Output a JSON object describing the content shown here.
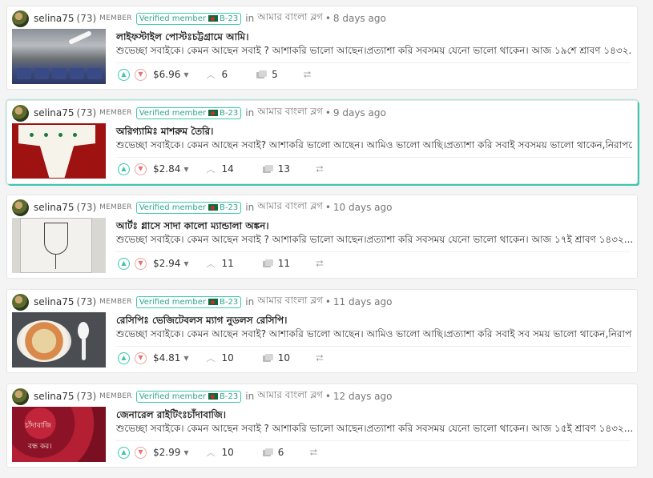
{
  "posts": [
    {
      "username": "selina75",
      "reputation": "(73)",
      "member_badge": "MEMBER",
      "verified": "Verified member",
      "verified_code": "B-23",
      "in_label": "in",
      "community": "আমার বাংলা ব্লগ",
      "age": "8 days ago",
      "title": "লাইফস্টাইল পোস্টঃচট্টগ্রামে আমি।",
      "excerpt": "শুভেচ্ছা সবাইকে। কেমন আছেন সবাই ? আশাকরি ভালো আছেন।প্রত্যাশা করি সবসময় যেনো ভালো থাকেন। আজ ১৯শে শ্রাবণ ১৪৩২...",
      "payout": "$6.96",
      "votes": "6",
      "comments": "5"
    },
    {
      "username": "selina75",
      "reputation": "(73)",
      "member_badge": "MEMBER",
      "verified": "Verified member",
      "verified_code": "B-23",
      "in_label": "in",
      "community": "আমার বাংলা ব্লগ",
      "age": "9 days ago",
      "title": "অরিগ্যামিঃ মাশরুম তৈরি।",
      "excerpt": "শুভেচ্ছা সবাইকে। কেমন আছেন সবাই? আশাকরি ভালো আছেন। আমিও ভালো আছি।প্রত্যাশা করি সবাই সবসময় ভালো থাকেন,নিরাপদে...",
      "payout": "$2.84",
      "votes": "14",
      "comments": "13"
    },
    {
      "username": "selina75",
      "reputation": "(73)",
      "member_badge": "MEMBER",
      "verified": "Verified member",
      "verified_code": "B-23",
      "in_label": "in",
      "community": "আমার বাংলা ব্লগ",
      "age": "10 days ago",
      "title": "আর্টঃ গ্লাসে সাদা কালো ম্যান্ডালা অঙ্কন।",
      "excerpt": "শুভেচ্ছা সবাইকে। কেমন আছেন সবাই ? আশাকরি ভালো আছেন।প্রত্যাশা করি সবসময় যেনো ভালো থাকেন। আজ ১৭ই শ্রাবণ ১৪৩২...",
      "payout": "$2.94",
      "votes": "11",
      "comments": "11"
    },
    {
      "username": "selina75",
      "reputation": "(73)",
      "member_badge": "MEMBER",
      "verified": "Verified member",
      "verified_code": "B-23",
      "in_label": "in",
      "community": "আমার বাংলা ব্লগ",
      "age": "11 days ago",
      "title": "রেসিপিঃ ভেজিটেবলস ম্যাগ নুডলস রেসিপি।",
      "excerpt": "শুভেচ্ছা সবাইকে। কেমন আছেন সবাই? আশাকরি ভালো আছেন। আমিও ভালো আছি।প্রত্যাশা করি সবাই সব সময় ভালো থাকেন,নিরাপদে...",
      "payout": "$4.81",
      "votes": "10",
      "comments": "10"
    },
    {
      "username": "selina75",
      "reputation": "(73)",
      "member_badge": "MEMBER",
      "verified": "Verified member",
      "verified_code": "B-23",
      "in_label": "in",
      "community": "আমার বাংলা ব্লগ",
      "age": "12 days ago",
      "title": "জেনারেল রাইটিংঃচাঁদাবাজি।",
      "excerpt": "শুভেচ্ছা সবাইকে। কেমন আছেন সবাই ? আশাকরি ভালো আছেন।প্রত্যাশা করি সবসময় যেনো ভালো থাকেন। আজ ১৫ই শ্রাবণ ১৪৩২...",
      "payout": "$2.99",
      "votes": "10",
      "comments": "6",
      "thumb_text_1": "চাঁদাবাজি",
      "thumb_text_2": "বন্ধ কর।"
    }
  ],
  "colors": {
    "accent": "#3cc8ae",
    "downvote": "#e57373",
    "flag_green": "#0a6a3a",
    "flag_red": "#d62828"
  },
  "icons": {
    "upvote": "chevron-up-circle-icon",
    "downvote": "chevron-down-circle-icon",
    "votes": "chevron-up-icon",
    "comments": "comments-icon",
    "resteem": "resteem-icon"
  }
}
